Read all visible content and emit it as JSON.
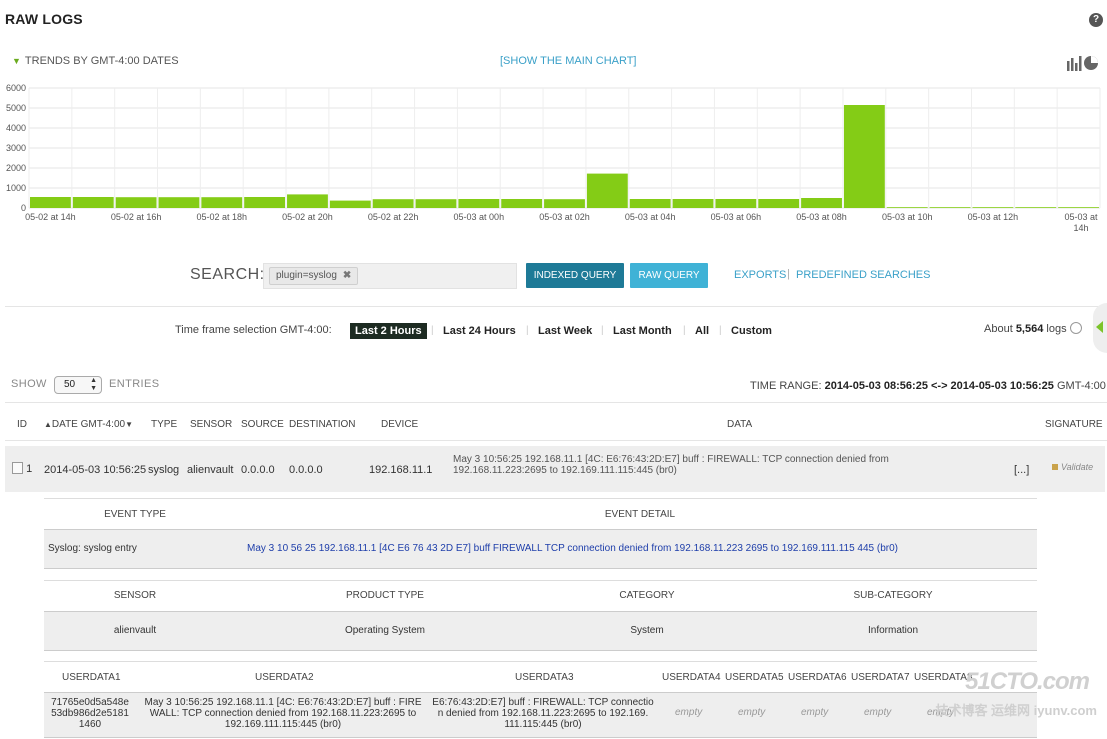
{
  "header": {
    "title": "RAW LOGS",
    "help_label": "?"
  },
  "trends": {
    "label": "TRENDS BY GMT-4:00 DATES",
    "show_main_chart": "[SHOW THE MAIN CHART]"
  },
  "chart_data": {
    "type": "bar",
    "categories": [
      "05-02 at 14h",
      "05-02 at 15h",
      "05-02 at 16h",
      "05-02 at 17h",
      "05-02 at 18h",
      "05-02 at 19h",
      "05-02 at 20h",
      "05-02 at 21h",
      "05-02 at 22h",
      "05-02 at 23h",
      "05-03 at 00h",
      "05-03 at 01h",
      "05-03 at 02h",
      "05-03 at 03h",
      "05-03 at 04h",
      "05-03 at 05h",
      "05-03 at 06h",
      "05-03 at 07h",
      "05-03 at 08h",
      "05-03 at 09h",
      "05-03 at 10h",
      "05-03 at 11h",
      "05-03 at 12h",
      "05-03 at 13h",
      "05-03 at 14h"
    ],
    "tick_labels": [
      "05-02 at 14h",
      "05-02 at 16h",
      "05-02 at 18h",
      "05-02 at 20h",
      "05-02 at 22h",
      "05-03 at 00h",
      "05-03 at 02h",
      "05-03 at 04h",
      "05-03 at 06h",
      "05-03 at 08h",
      "05-03 at 10h",
      "05-03 at 12h",
      "05-03 at 14h"
    ],
    "values": [
      550,
      550,
      540,
      540,
      540,
      550,
      680,
      370,
      440,
      440,
      450,
      450,
      440,
      1720,
      450,
      450,
      450,
      450,
      500,
      5150,
      40,
      40,
      40,
      40,
      40
    ],
    "yticks": [
      0,
      1000,
      2000,
      3000,
      4000,
      5000,
      6000
    ],
    "ylim": [
      0,
      6000
    ],
    "color": "#84cc16",
    "grid": true
  },
  "search": {
    "label": "SEARCH:",
    "tag": "plugin=syslog",
    "tag_remove": "✖",
    "indexed_query": "INDEXED QUERY",
    "raw_query": "RAW QUERY",
    "exports": "EXPORTS",
    "separator": "|",
    "predefined": "PREDEFINED SEARCHES"
  },
  "timeframe": {
    "label": "Time frame selection GMT-4:00:",
    "options": [
      "Last 2 Hours",
      "Last 24 Hours",
      "Last Week",
      "Last Month",
      "All",
      "Custom"
    ],
    "selected": "Last 2 Hours",
    "about_prefix": "About",
    "about_count": "5,564",
    "about_suffix": "logs"
  },
  "list": {
    "show_label": "SHOW",
    "page_size": "50",
    "entries_label": "ENTRIES",
    "time_range_label": "TIME RANGE:",
    "time_range_value": "2014-05-03 08:56:25 <-> 2014-05-03 10:56:25",
    "time_range_tz": "GMT-4:00"
  },
  "table": {
    "columns": [
      "ID",
      "DATE GMT-4:00",
      "TYPE",
      "SENSOR",
      "SOURCE",
      "DESTINATION",
      "DEVICE",
      "DATA",
      "SIGNATURE"
    ],
    "row": {
      "id": "1",
      "date": "2014-05-03 10:56:25",
      "type": "syslog",
      "sensor": "alienvault",
      "source": "0.0.0.0",
      "destination": "0.0.0.0",
      "device": "192.168.11.1",
      "data_line1": "May 3 10:56:25 192.168.11.1 [4C: E6:76:43:2D:E7] buff : FIREWALL: TCP connection denied from",
      "data_line2": "192.168.11.223:2695 to 192.169.111.115:445 (br0)",
      "more": "[...]",
      "signature": "Validate"
    }
  },
  "detail": {
    "event_type_header": "EVENT TYPE",
    "event_detail_header": "EVENT DETAIL",
    "event_type": "Syslog: syslog entry",
    "event_detail": "May 3 10 56 25 192.168.11.1 [4C E6 76 43 2D E7] buff FIREWALL TCP connection denied from 192.168.11.223 2695 to 192.169.111.115 445 (br0)",
    "sensor_header": "SENSOR",
    "product_type_header": "PRODUCT TYPE",
    "category_header": "CATEGORY",
    "sub_category_header": "SUB-CATEGORY",
    "sensor": "alienvault",
    "product_type": "Operating System",
    "category": "System",
    "sub_category": "Information",
    "userdata_headers": [
      "USERDATA1",
      "USERDATA2",
      "USERDATA3",
      "USERDATA4",
      "USERDATA5",
      "USERDATA6",
      "USERDATA7",
      "USERDATA8"
    ],
    "userdata1": [
      "71765e0d5a548e",
      "53db986d2e5181",
      "1460"
    ],
    "userdata2": [
      "May 3 10:56:25 192.168.11.1 [4C: E6:76:43:2D:E7] buff : FIRE",
      "WALL: TCP connection denied from 192.168.11.223:2695 to",
      "192.169.111.115:445 (br0)"
    ],
    "userdata3": [
      "E6:76:43:2D:E7] buff : FIREWALL: TCP connectio",
      "n denied from 192.168.11.223:2695 to 192.169.",
      "111.115:445 (br0)"
    ],
    "empty_label": "empty"
  },
  "watermark": {
    "line1": "51CTO.com",
    "line2": "技术博客 运维网 iyunv.com"
  }
}
